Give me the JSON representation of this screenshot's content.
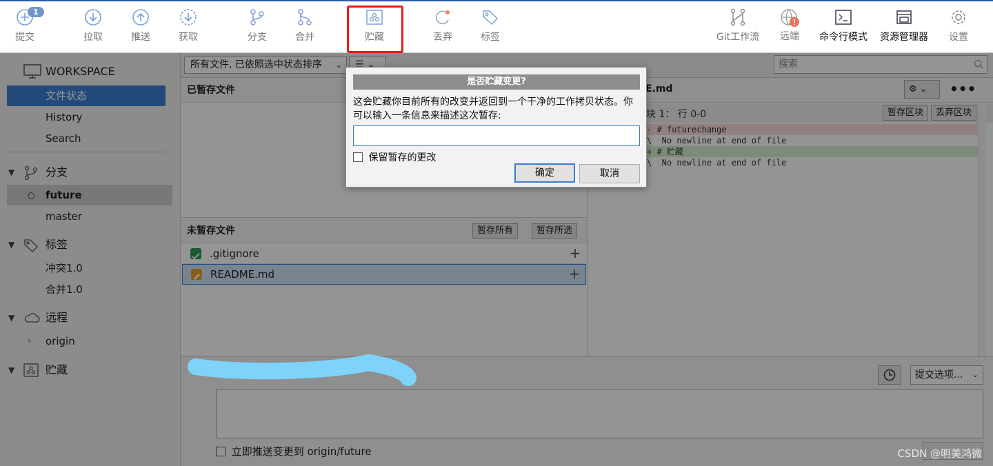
{
  "toolbar": {
    "commit": {
      "label": "提交",
      "badge": "1"
    },
    "pull": {
      "label": "拉取"
    },
    "push": {
      "label": "推送"
    },
    "fetch": {
      "label": "获取"
    },
    "branch": {
      "label": "分支"
    },
    "merge": {
      "label": "合并"
    },
    "stash": {
      "label": "贮藏"
    },
    "discard": {
      "label": "丢弃"
    },
    "tag": {
      "label": "标签"
    },
    "gitflow": {
      "label": "Git工作流"
    },
    "remote": {
      "label": "远端"
    },
    "terminal": {
      "label": "命令行模式"
    },
    "explorer": {
      "label": "资源管理器"
    },
    "settings": {
      "label": "设置"
    }
  },
  "sidebar": {
    "workspace": "WORKSPACE",
    "file_status": "文件状态",
    "history": "History",
    "search": "Search",
    "branches": {
      "label": "分支",
      "items": [
        "future",
        "master"
      ]
    },
    "tags": {
      "label": "标签",
      "items": [
        "冲突1.0",
        "合并1.0"
      ]
    },
    "remotes": {
      "label": "远程",
      "items": [
        "origin"
      ]
    },
    "stashes": {
      "label": "贮藏"
    }
  },
  "filter": {
    "sort_label": "所有文件, 已依照选中状态排序",
    "search_placeholder": "搜索"
  },
  "staged": {
    "title": "已暂存文件"
  },
  "unstaged": {
    "title": "未暂存文件",
    "stage_all": "暂存所有",
    "stage_selected": "暂存所选",
    "files": [
      {
        "name": ".gitignore",
        "status": "added"
      },
      {
        "name": "README.md",
        "status": "modified"
      }
    ]
  },
  "diff": {
    "file": "E.md",
    "hunk": "块 1： 行 0-0",
    "stage_hunk": "暂存区块",
    "discard_hunk": "丢弃区块",
    "lines": [
      {
        "sign": "-",
        "text": " # futurechange",
        "kind": "del"
      },
      {
        "sign": "\\",
        "text": "  No newline at end of file",
        "kind": "ctx"
      },
      {
        "sign": "+",
        "text": " # 贮藏",
        "kind": "add"
      },
      {
        "sign": "\\",
        "text": "  No newline at end of file",
        "kind": "ctx"
      }
    ]
  },
  "commit": {
    "options": "提交选项...",
    "push_immediately": "立即推送变更到 origin/future"
  },
  "dialog": {
    "title": "是否贮藏变更?",
    "message": "这会贮藏你目前所有的改变并返回到一个干净的工作拷贝状态。你可以输入一条信息来描述这次暂存:",
    "keep_staged": "保留暂存的更改",
    "ok": "确定",
    "cancel": "取消"
  },
  "watermark": "CSDN @明美鸿微",
  "colors": {
    "accent": "#3d80d4",
    "highlight_red": "#e8191e",
    "scribble": "#7fd3fb"
  }
}
